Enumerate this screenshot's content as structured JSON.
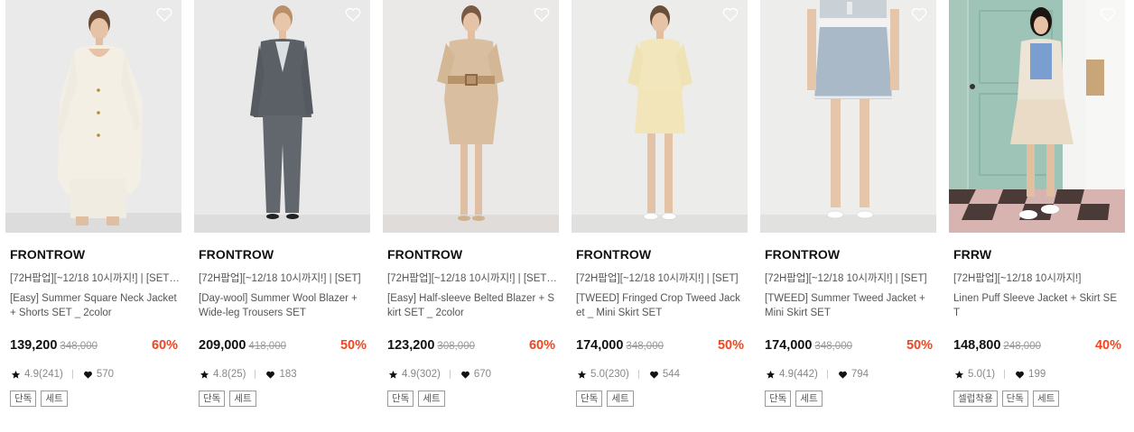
{
  "products": [
    {
      "brand": "FRONTROW",
      "promo": "[72H팝업][~12/18 10시까지!] | [SET][…",
      "name": "[Easy] Summer Square Neck Jacket + Shorts SET _ 2color",
      "price": "139,200",
      "original_price": "348,000",
      "discount": "60%",
      "rating": "4.9(241)",
      "likes": "570",
      "tags": [
        "단독",
        "세트"
      ],
      "image_alt": "Model in ivory square-neck jacket and shorts"
    },
    {
      "brand": "FRONTROW",
      "promo": "[72H팝업][~12/18 10시까지!] | [SET]",
      "name": "[Day-wool] Summer Wool Blazer + Wide-leg Trousers SET",
      "price": "209,000",
      "original_price": "418,000",
      "discount": "50%",
      "rating": "4.8(25)",
      "likes": "183",
      "tags": [
        "단독",
        "세트"
      ],
      "image_alt": "Model in grey wool blazer and wide-leg trousers"
    },
    {
      "brand": "FRONTROW",
      "promo": "[72H팝업][~12/18 10시까지!] | [SET][…",
      "name": "[Easy] Half-sleeve Belted Blazer + Skirt SET _ 2color",
      "price": "123,200",
      "original_price": "308,000",
      "discount": "60%",
      "rating": "4.9(302)",
      "likes": "670",
      "tags": [
        "단독",
        "세트"
      ],
      "image_alt": "Model in beige belted blazer and skirt"
    },
    {
      "brand": "FRONTROW",
      "promo": "[72H팝업][~12/18 10시까지!] | [SET]",
      "name": "[TWEED] Fringed Crop Tweed Jacket _ Mini Skirt SET",
      "price": "174,000",
      "original_price": "348,000",
      "discount": "50%",
      "rating": "5.0(230)",
      "likes": "544",
      "tags": [
        "단독",
        "세트"
      ],
      "image_alt": "Model in butter yellow tweed jacket and mini skirt"
    },
    {
      "brand": "FRONTROW",
      "promo": "[72H팝업][~12/18 10시까지!] | [SET]",
      "name": "[TWEED] Summer Tweed Jacket + Mini Skirt SET",
      "price": "174,000",
      "original_price": "348,000",
      "discount": "50%",
      "rating": "4.9(442)",
      "likes": "794",
      "tags": [
        "단독",
        "세트"
      ],
      "image_alt": "Model in light blue tweed mini skirt"
    },
    {
      "brand": "FRRW",
      "promo": "[72H팝업][~12/18 10시까지!]",
      "name": "Linen Puff Sleeve Jacket + Skirt SET",
      "price": "148,800",
      "original_price": "248,000",
      "discount": "40%",
      "rating": "5.0(1)",
      "likes": "199",
      "tags": [
        "셀럽착용",
        "단독",
        "세트"
      ],
      "image_alt": "Model in linen jacket and pleated skirt by a door"
    }
  ],
  "colors": {
    "discount": "#f1461f",
    "text": "#111111",
    "muted": "#999999"
  },
  "icons": {
    "wishlist": "heart-outline-icon",
    "rating": "star-icon",
    "likes": "heart-filled-icon"
  }
}
